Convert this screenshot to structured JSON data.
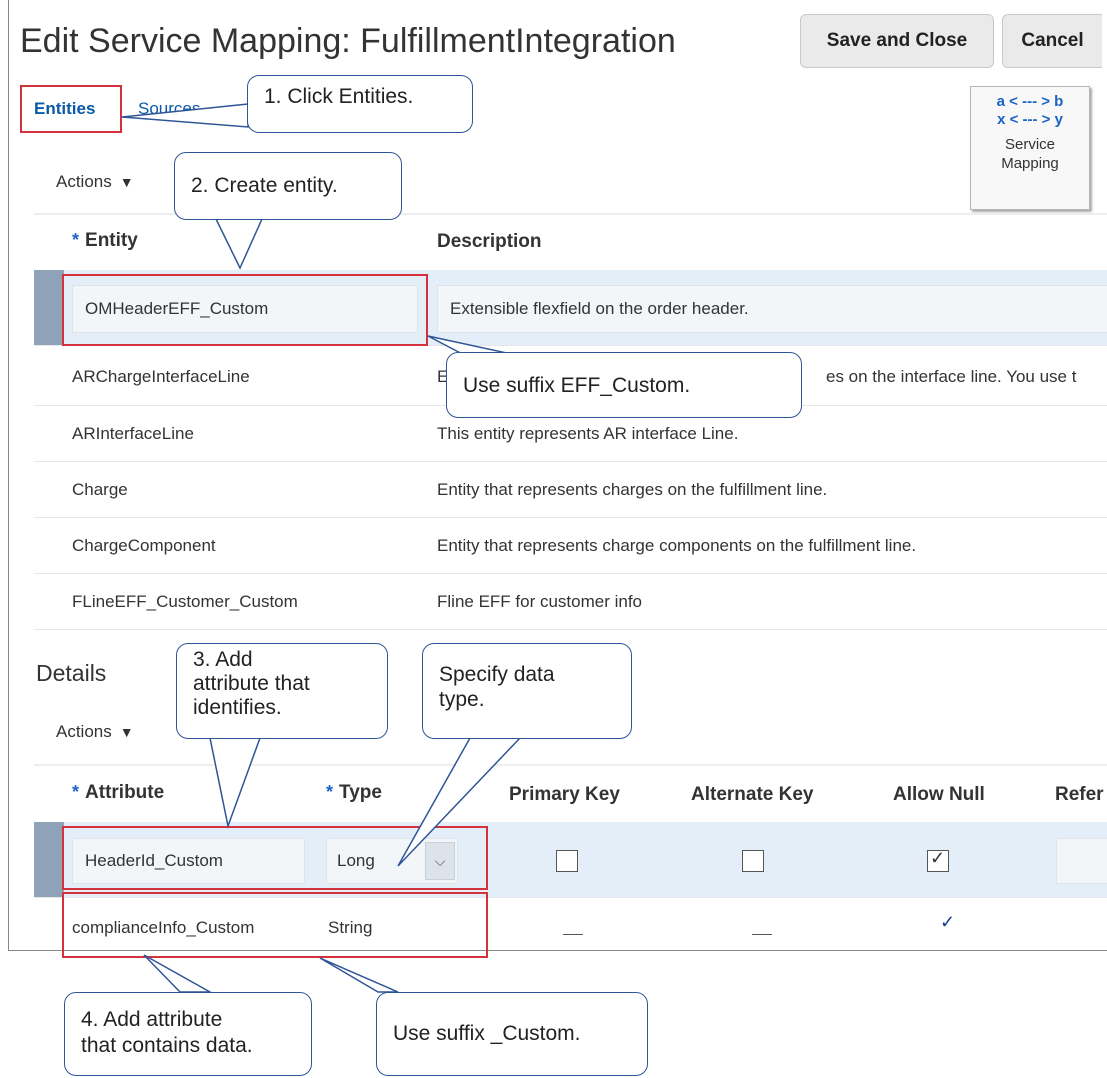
{
  "page": {
    "title": "Edit Service Mapping: FulfillmentIntegration",
    "save_close_label": "Save and Close",
    "cancel_label": "Cancel"
  },
  "tabs": [
    {
      "label": "Entities",
      "selected": true
    },
    {
      "label": "Sources",
      "selected": false
    }
  ],
  "service_mapping_button": {
    "line1": "a < --- > b",
    "line2": "x < --- > y",
    "label_line1": "Service",
    "label_line2": "Mapping"
  },
  "entities": {
    "actions_label": "Actions",
    "columns": {
      "entity": "Entity",
      "description": "Description"
    },
    "rows": [
      {
        "entity": "OMHeaderEFF_Custom",
        "description": "Extensible flexfield on the order header."
      },
      {
        "entity": "ARChargeInterfaceLine",
        "description": "E",
        "description_tail": "es on the interface line. You use t"
      },
      {
        "entity": "ARInterfaceLine",
        "description": "This entity represents AR interface Line."
      },
      {
        "entity": "Charge",
        "description": "Entity that represents charges on the fulfillment line."
      },
      {
        "entity": "ChargeComponent",
        "description": "Entity that represents charge components on the fulfillment line."
      },
      {
        "entity": "FLineEFF_Customer_Custom",
        "description": "Fline EFF for customer info"
      }
    ]
  },
  "details": {
    "title": "Details",
    "actions_label": "Actions",
    "columns": {
      "attribute": "Attribute",
      "type": "Type",
      "primary_key": "Primary Key",
      "alternate_key": "Alternate Key",
      "allow_null": "Allow Null",
      "reference": "Refer"
    },
    "rows": [
      {
        "attribute": "HeaderId_Custom",
        "type": "Long",
        "primary_key": false,
        "alternate_key": false,
        "allow_null": true
      },
      {
        "attribute": "complianceInfo_Custom",
        "type": "String",
        "primary_key": "—",
        "alternate_key": "—",
        "allow_null": "✓"
      }
    ]
  },
  "callouts": {
    "c1": "1. Click Entities.",
    "c2": "2. Create entity.",
    "c3": "Use suffix EFF_Custom.",
    "c4_line1": "3. Add",
    "c4_line2": "attribute that",
    "c4_line3": "identifies.",
    "c5_line1": "Specify data",
    "c5_line2": "type.",
    "c6_line1": "4. Add attribute",
    "c6_line2": "that contains data.",
    "c7": "Use suffix _Custom."
  },
  "colors": {
    "accent": "#0a5aa8",
    "highlight_box": "#d3313b",
    "callout_border": "#2f5597",
    "selected_row": "#e4eef9"
  }
}
